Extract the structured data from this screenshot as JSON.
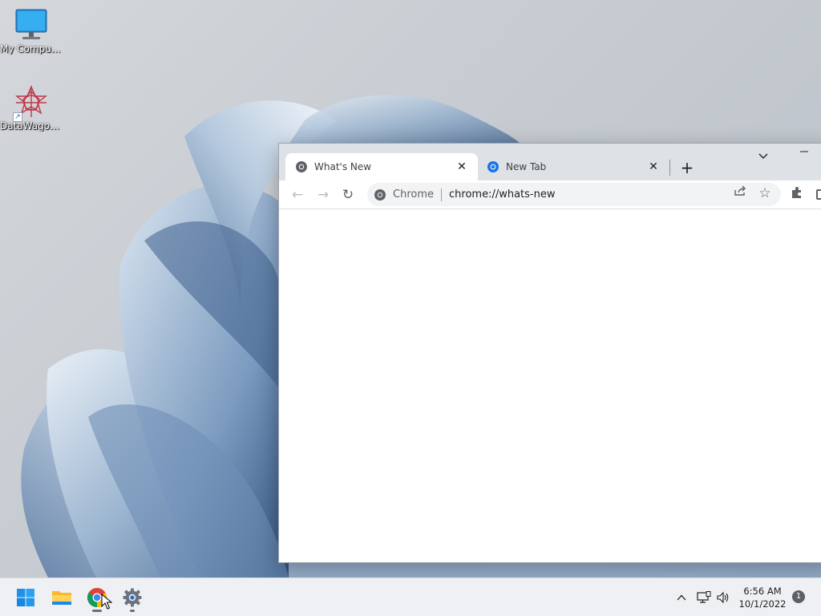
{
  "desktop": {
    "icons": [
      {
        "label": "My Computer",
        "icon": "monitor-icon"
      },
      {
        "label": "DataWagon...",
        "icon": "datawagon-app-icon",
        "shortcut": true
      }
    ]
  },
  "browser": {
    "tabs": [
      {
        "title": "What's New",
        "active": true,
        "favicon": "chrome-icon"
      },
      {
        "title": "New Tab",
        "active": false,
        "favicon": "chrome-blue-icon"
      }
    ],
    "tab_close_glyph": "✕",
    "new_tab_glyph": "+",
    "tab_search_glyph": "⌵",
    "minimize_glyph": "—",
    "omnibox": {
      "chip_label": "Chrome",
      "url": "chrome://whats-new"
    },
    "nav": {
      "back_glyph": "←",
      "forward_glyph": "→",
      "reload_glyph": "↻"
    },
    "share_glyph": "⇪",
    "bookmark_glyph": "☆"
  },
  "taskbar": {
    "apps": [
      {
        "name": "Start",
        "icon": "windows-start-icon"
      },
      {
        "name": "File Explorer",
        "icon": "folder-icon"
      },
      {
        "name": "Google Chrome",
        "icon": "chrome-icon",
        "running": true
      },
      {
        "name": "Settings",
        "icon": "gear-icon",
        "running": true
      }
    ],
    "tray": {
      "chevron_glyph": "^",
      "time": "6:56 AM",
      "date": "10/1/2022",
      "notifications": "1"
    }
  },
  "colors": {
    "accent_blue": "#1a73e8",
    "tabstrip": "#dee1e6",
    "taskbar": "#eef0f3"
  }
}
